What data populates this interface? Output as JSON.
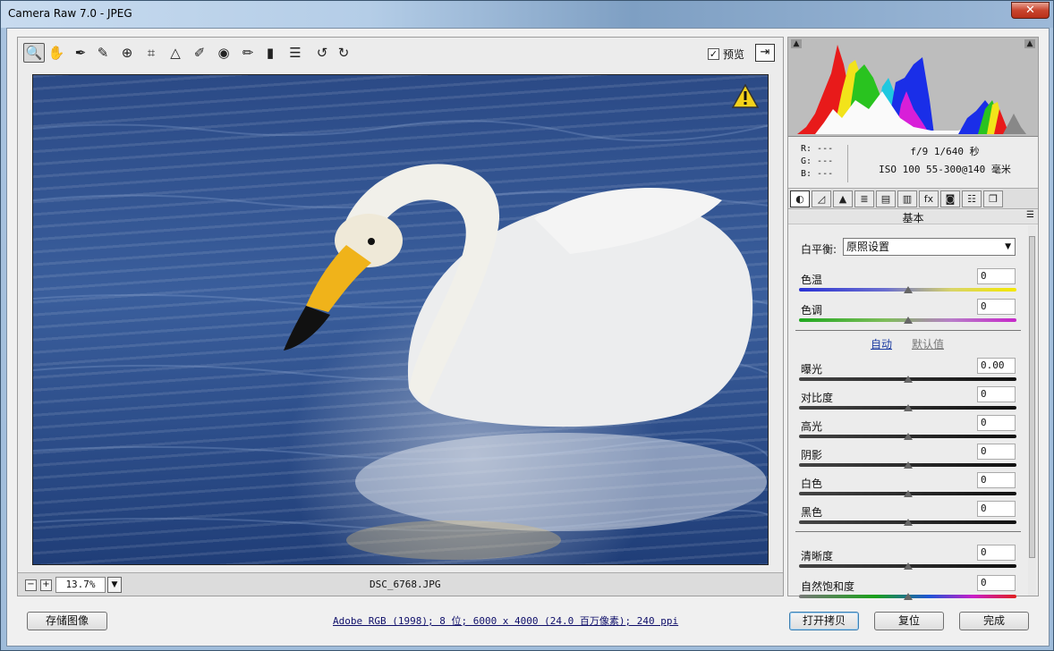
{
  "window": {
    "title": "Camera Raw 7.0 -  JPEG",
    "close_glyph": "✕"
  },
  "toolbar": {
    "tools": [
      {
        "name": "zoom-tool-icon",
        "glyph": "🔍"
      },
      {
        "name": "hand-tool-icon",
        "glyph": "✋"
      },
      {
        "name": "white-balance-tool-icon",
        "glyph": "✒"
      },
      {
        "name": "color-sampler-tool-icon",
        "glyph": "✎"
      },
      {
        "name": "target-adjustment-tool-icon",
        "glyph": "⊕"
      },
      {
        "name": "crop-tool-icon",
        "glyph": "⌗"
      },
      {
        "name": "straighten-tool-icon",
        "glyph": "△"
      },
      {
        "name": "spot-removal-tool-icon",
        "glyph": "✐"
      },
      {
        "name": "red-eye-tool-icon",
        "glyph": "◉"
      },
      {
        "name": "adjustment-brush-icon",
        "glyph": "✏"
      },
      {
        "name": "graduated-filter-icon",
        "glyph": "▮"
      },
      {
        "name": "preferences-icon",
        "glyph": "☰"
      },
      {
        "name": "rotate-left-icon",
        "glyph": "↺"
      },
      {
        "name": "rotate-right-icon",
        "glyph": "↻"
      }
    ],
    "preview_label": "预览",
    "preview_checked": "✓",
    "fullscreen_glyph": "⇥"
  },
  "statusbar": {
    "zoom_out": "−",
    "zoom_in": "+",
    "zoom_value": "13.7%",
    "zoom_dropdown": "▼",
    "filename": "DSC_6768.JPG"
  },
  "readout": {
    "r": "R:  ---",
    "g": "G:  ---",
    "b": "B:  ---",
    "exposure": "f/9   1/640 秒",
    "iso_lens": "ISO 100   55-300@140 毫米"
  },
  "panel": {
    "tabs": [
      "◐",
      "◿",
      "▲",
      "≣",
      "▤",
      "▥",
      "fx",
      "◙",
      "☷",
      "❐"
    ],
    "title": "基本",
    "menu_glyph": "☰"
  },
  "white_balance": {
    "label": "白平衡:",
    "value": "原照设置",
    "arrow": "▼"
  },
  "sliders_wb": [
    {
      "label": "色温",
      "value": "0",
      "track": "temp",
      "level": 0.5
    },
    {
      "label": "色调",
      "value": "0",
      "track": "tint",
      "level": 0.5
    }
  ],
  "auto_links": {
    "auto": "自动",
    "default": "默认值"
  },
  "sliders_tone": [
    {
      "label": "曝光",
      "value": "0.00",
      "level": 0.5
    },
    {
      "label": "对比度",
      "value": "0",
      "level": 0.5
    },
    {
      "label": "高光",
      "value": "0",
      "level": 0.5
    },
    {
      "label": "阴影",
      "value": "0",
      "level": 0.5
    },
    {
      "label": "白色",
      "value": "0",
      "level": 0.5
    },
    {
      "label": "黑色",
      "value": "0",
      "level": 0.5
    }
  ],
  "sliders_presence": [
    {
      "label": "清晰度",
      "value": "0",
      "track": "plain",
      "level": 0.5
    },
    {
      "label": "自然饱和度",
      "value": "0",
      "track": "sat",
      "level": 0.5
    }
  ],
  "bottom": {
    "save_image": "存储图像",
    "workflow_link": "Adobe RGB (1998); 8 位; 6000 x 4000 (24.0 百万像素); 240 ppi",
    "open_copy": "打开拷贝",
    "reset": "复位",
    "done": "完成"
  },
  "colors": {
    "accent": "#3c7fb1",
    "link": "#10106a",
    "water": "#2b4a86"
  }
}
